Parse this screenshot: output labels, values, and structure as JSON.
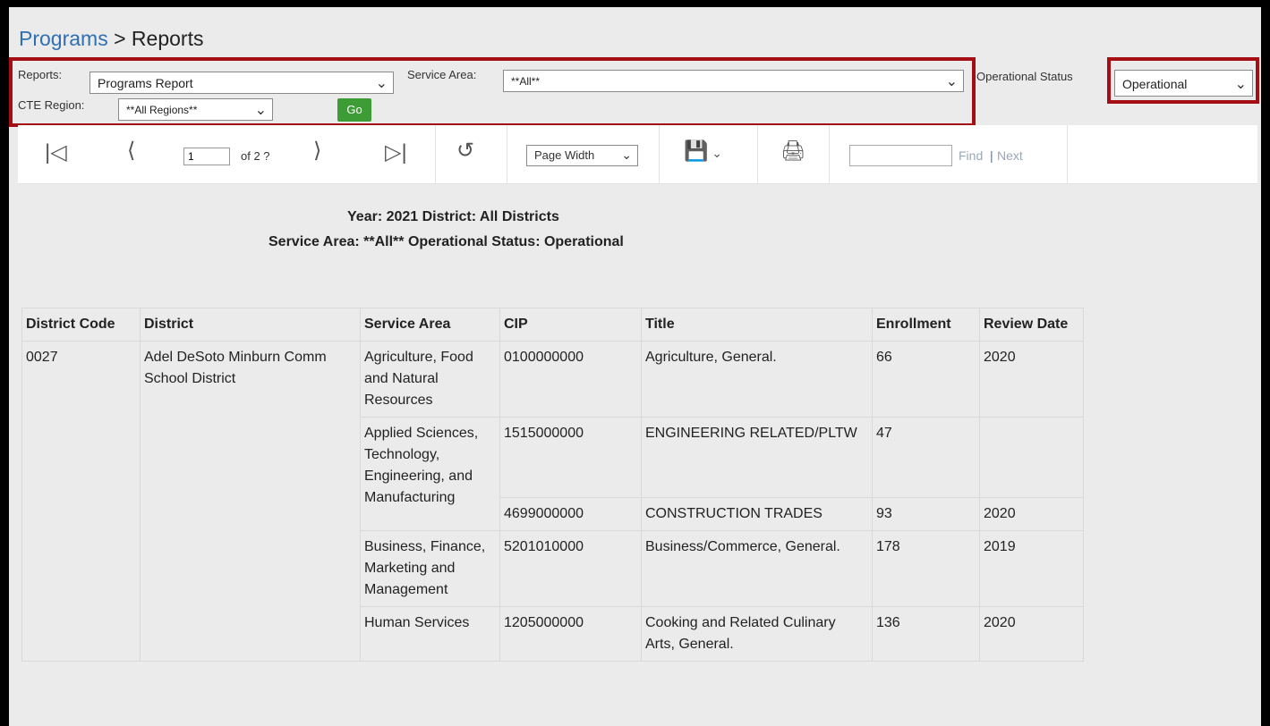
{
  "breadcrumb": {
    "link": "Programs",
    "separator": ">",
    "current": "Reports"
  },
  "filters": {
    "reports_label": "Reports:",
    "reports_value": "Programs Report",
    "service_area_label": "Service Area:",
    "service_area_value": "**All**",
    "operational_status_label": "Operational Status",
    "operational_status_value": "Operational",
    "cte_region_label": "CTE Region:",
    "cte_region_value": "**All Regions**",
    "go_label": "Go"
  },
  "toolbar": {
    "first_icon": "first-page-icon",
    "prev_icon": "prev-page-icon",
    "page_input": "1",
    "of_text": "of 2 ?",
    "next_icon": "next-page-icon",
    "last_icon": "last-page-icon",
    "back_icon": "back-icon",
    "zoom_value": "Page Width",
    "save_icon": "save-icon",
    "print_icon": "print-icon",
    "find_label": "Find",
    "find_sep": "|",
    "next_label": "Next"
  },
  "report": {
    "header_line1": "Year: 2021 District: All Districts",
    "header_line2": "Service Area: **All** Operational Status: Operational",
    "columns": [
      "District Code",
      "District",
      "Service Area",
      "CIP",
      "Title",
      "Enrollment",
      "Review Date"
    ],
    "district_code": "0027",
    "district": "Adel DeSoto Minburn Comm School District",
    "rows": [
      {
        "service_area": "Agriculture, Food and Natural Resources",
        "cip": "0100000000",
        "title": "Agriculture, General.",
        "enrollment": "66",
        "review_date": "2020"
      },
      {
        "service_area": "Applied Sciences, Technology, Engineering, and Manufacturing",
        "cip": "1515000000",
        "title": "ENGINEERING RELATED/PLTW",
        "enrollment": "47",
        "review_date": ""
      },
      {
        "cip": "4699000000",
        "title": "CONSTRUCTION TRADES",
        "enrollment": "93",
        "review_date": "2020"
      },
      {
        "service_area": "Business, Finance, Marketing and Management",
        "cip": "5201010000",
        "title": "Business/Commerce, General.",
        "enrollment": "178",
        "review_date": "2019"
      },
      {
        "service_area": "Human Services",
        "cip": "1205000000",
        "title": "Cooking and Related Culinary Arts, General.",
        "enrollment": "136",
        "review_date": "2020"
      }
    ]
  },
  "colors": {
    "highlight": "#a40e14",
    "go_button": "#3e9c37",
    "link": "#2f6fb3"
  }
}
